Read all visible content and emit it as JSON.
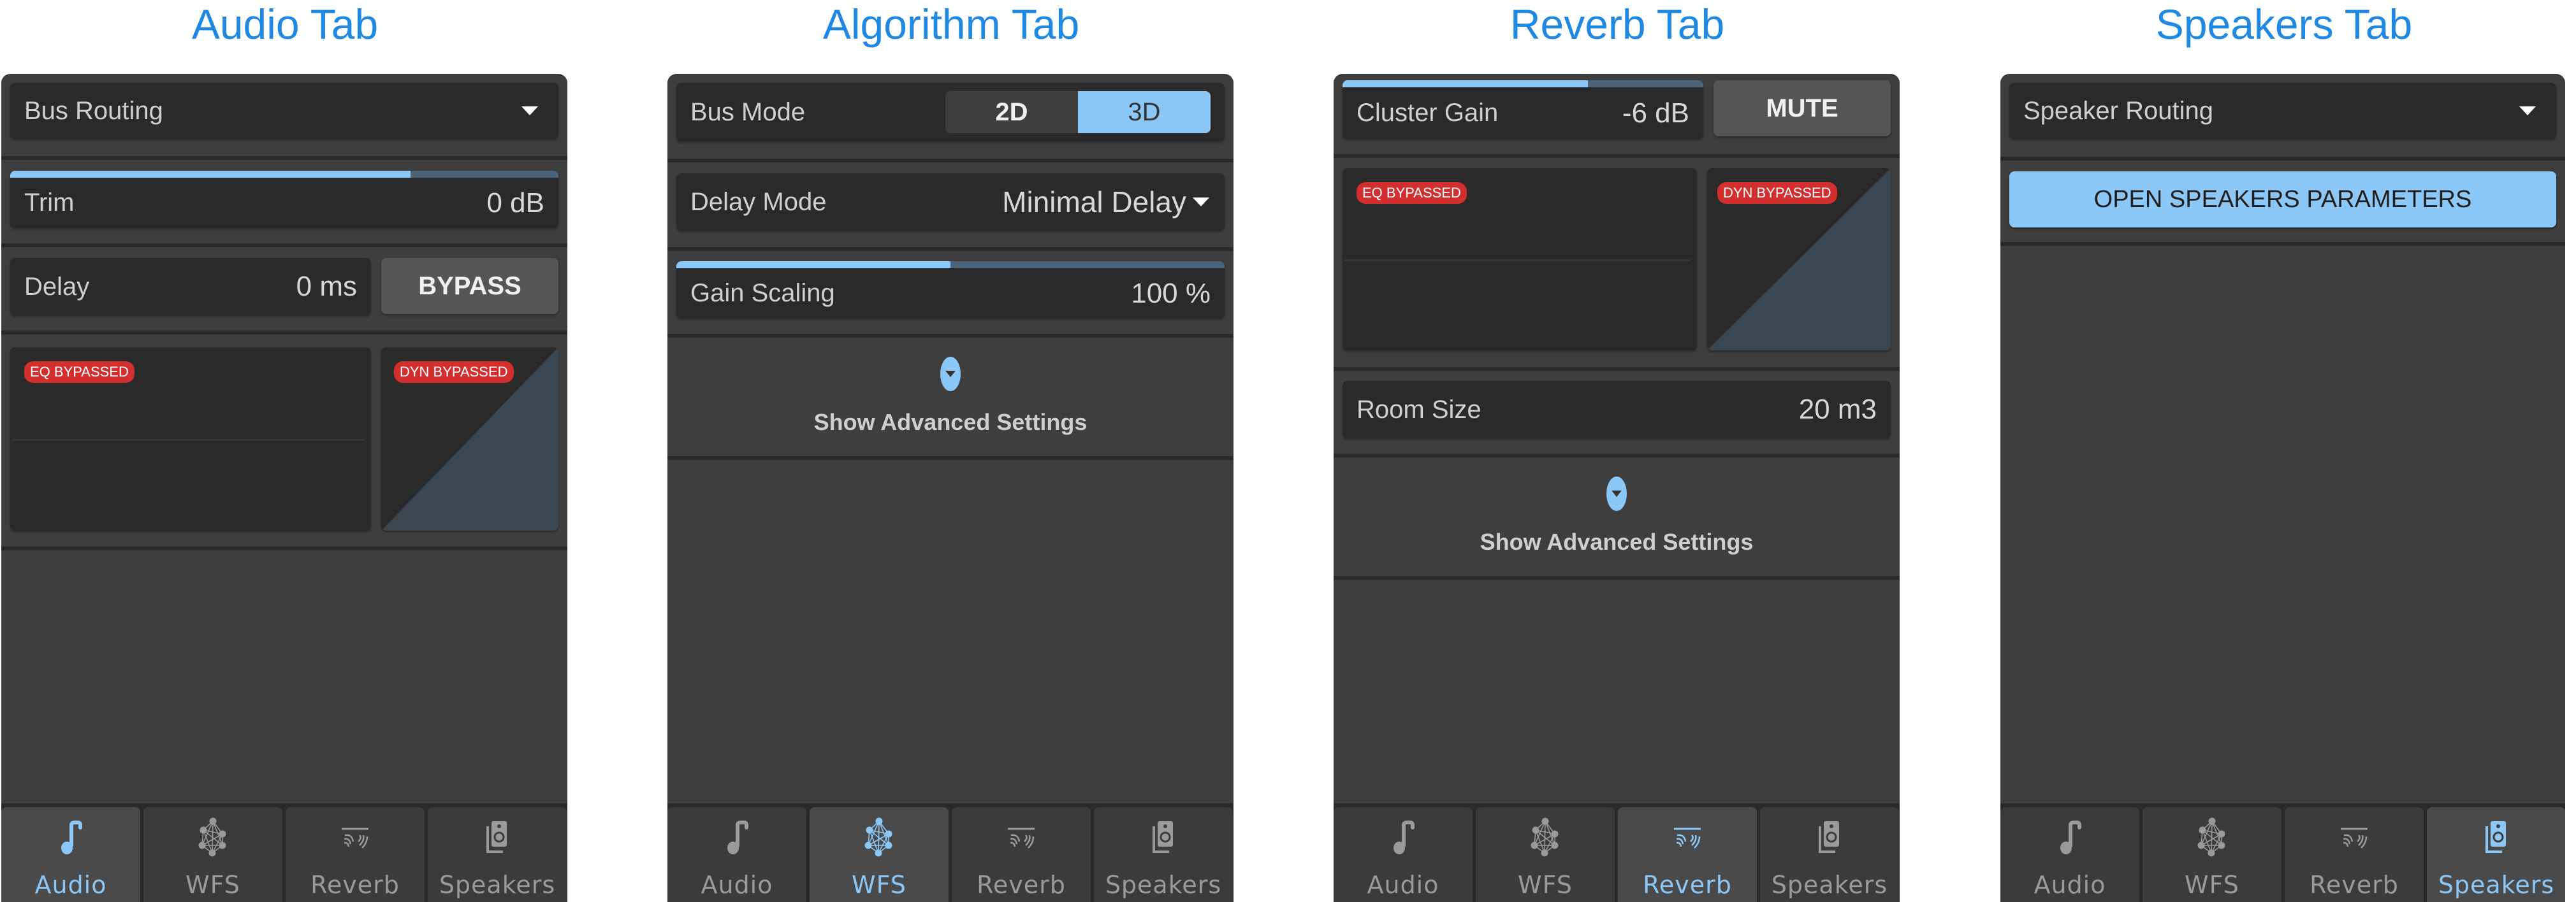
{
  "colors": {
    "accent": "#8cc8f7",
    "title": "#1e88e5",
    "panel_bg": "#3e3e3e",
    "box_bg": "#2a2a2a",
    "badge_red": "#d32f2f",
    "nav_inactive": "#9a9a9a"
  },
  "nav": {
    "items": [
      {
        "label": "Audio",
        "icon": "music-note-icon"
      },
      {
        "label": "WFS",
        "icon": "network-nodes-icon"
      },
      {
        "label": "Reverb",
        "icon": "reverb-waves-icon"
      },
      {
        "label": "Speakers",
        "icon": "speaker-icon"
      }
    ]
  },
  "audio": {
    "title": "Audio Tab",
    "active_nav": 0,
    "routing": {
      "label": "Bus Routing"
    },
    "trim": {
      "label": "Trim",
      "value": "0 dB",
      "fill_fraction": 0.73
    },
    "delay": {
      "label": "Delay",
      "value": "0 ms"
    },
    "bypass_button": "BYPASS",
    "eq_badge": "EQ BYPASSED",
    "dyn_badge": "DYN BYPASSED"
  },
  "algorithm": {
    "title": "Algorithm Tab",
    "active_nav": 1,
    "bus_mode": {
      "label": "Bus Mode",
      "options": [
        "2D",
        "3D"
      ],
      "selected": "3D"
    },
    "delay_mode": {
      "label": "Delay Mode",
      "value": "Minimal Delay"
    },
    "gain_scaling": {
      "label": "Gain Scaling",
      "value": "100 %",
      "fill_fraction": 0.5
    },
    "advanced_label": "Show Advanced Settings"
  },
  "reverb": {
    "title": "Reverb Tab",
    "active_nav": 2,
    "cluster_gain": {
      "label": "Cluster Gain",
      "value": "-6 dB",
      "fill_fraction": 0.68
    },
    "mute_button": "MUTE",
    "eq_badge": "EQ BYPASSED",
    "dyn_badge": "DYN BYPASSED",
    "room_size": {
      "label": "Room Size",
      "value": "20 m3"
    },
    "advanced_label": "Show Advanced Settings"
  },
  "speakers": {
    "title": "Speakers Tab",
    "active_nav": 3,
    "routing": {
      "label": "Speaker Routing"
    },
    "open_button": "OPEN SPEAKERS PARAMETERS"
  }
}
